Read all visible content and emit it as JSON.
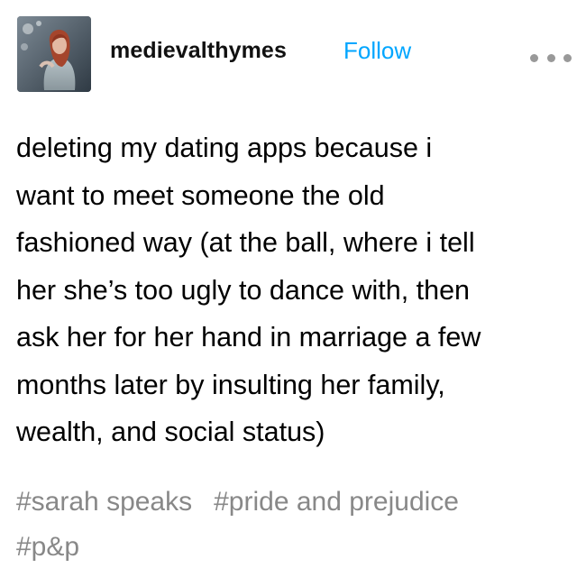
{
  "post": {
    "author": {
      "username": "medievalthymes",
      "avatar_icon": "profile-photo"
    },
    "follow_label": "Follow",
    "more_icon": "more-dots-icon",
    "body_lines": [
      "deleting my dating apps because i",
      "want to meet someone the old",
      "fashioned way (at the ball, where i tell",
      "her she’s too ugly to dance with, then",
      "ask her for her hand in marriage a few",
      "months later by insulting her family,",
      "wealth, and social status)"
    ],
    "tags": [
      "#sarah speaks",
      "#pride and prejudice",
      "#p&p"
    ]
  },
  "colors": {
    "follow": "#00a6ff",
    "tags": "#888888",
    "more_dots": "#999999"
  }
}
